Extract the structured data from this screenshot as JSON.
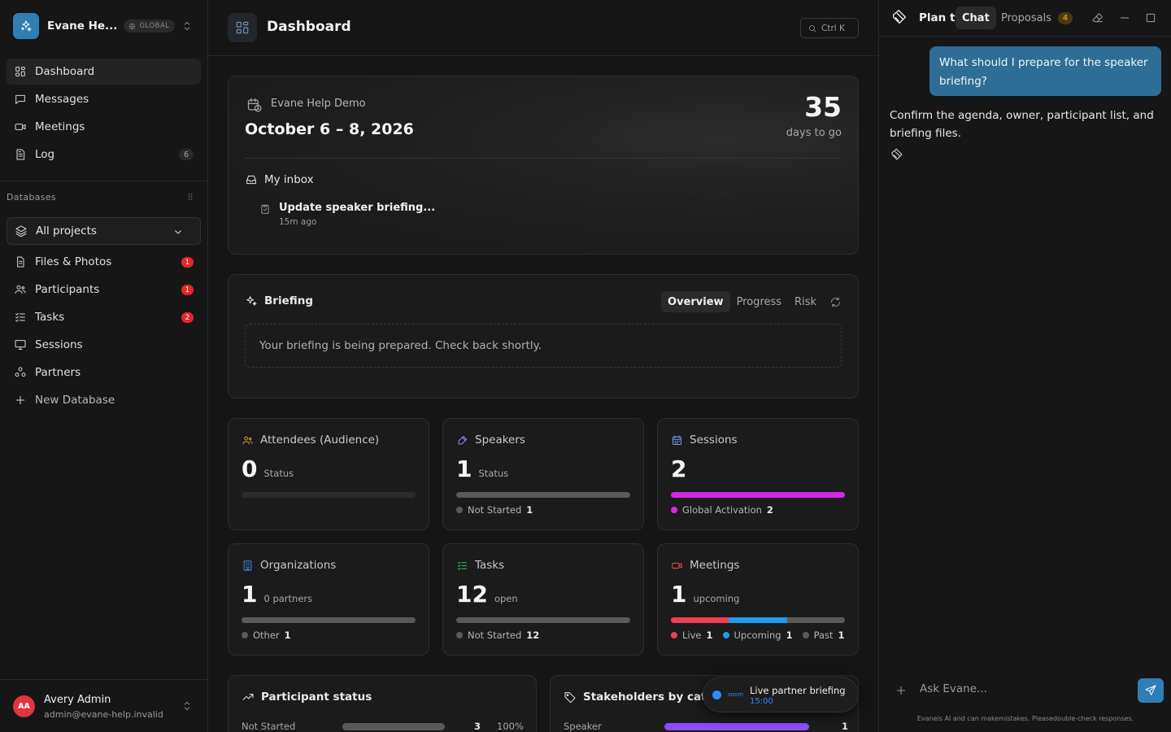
{
  "workspace": {
    "name": "Evane He...",
    "badge": "GLOBAL"
  },
  "nav": [
    {
      "label": "Dashboard",
      "icon": "dashboard-icon",
      "active": true
    },
    {
      "label": "Messages",
      "icon": "message-icon"
    },
    {
      "label": "Meetings",
      "icon": "video-icon"
    },
    {
      "label": "Log",
      "icon": "log-icon",
      "count": "6"
    }
  ],
  "databases": {
    "heading": "Databases",
    "selector": "All projects",
    "items": [
      {
        "label": "Files & Photos",
        "icon": "file-icon",
        "count": "1"
      },
      {
        "label": "Participants",
        "icon": "participants-icon",
        "count": "1"
      },
      {
        "label": "Tasks",
        "icon": "tasks-icon",
        "count": "2"
      },
      {
        "label": "Sessions",
        "icon": "sessions-icon"
      },
      {
        "label": "Partners",
        "icon": "partners-icon"
      }
    ],
    "new_label": "New Database"
  },
  "user": {
    "initials": "AA",
    "name": "Avery Admin",
    "email": "admin@evane-help.invalid"
  },
  "header": {
    "title": "Dashboard",
    "shortcut": "Ctrl K"
  },
  "event": {
    "name": "Evane Help Demo",
    "dates": "October 6 – 8, 2026",
    "days": "35",
    "days_label": "days to go",
    "inbox_title": "My inbox",
    "inbox_item": {
      "title": "Update speaker briefing...",
      "time": "15m ago"
    }
  },
  "briefing": {
    "title": "Briefing",
    "tabs": [
      "Overview",
      "Progress",
      "Risk"
    ],
    "active_tab": "Overview",
    "message": "Your briefing is being prepared. Check back shortly."
  },
  "stats": [
    {
      "title": "Attendees (Audience)",
      "icon": "attendees-icon",
      "icon_color": "#e6a23c",
      "value": "0",
      "sub": "Status",
      "bar": [],
      "legend": []
    },
    {
      "title": "Speakers",
      "icon": "speaker-icon",
      "icon_color": "#a78bfa",
      "value": "1",
      "sub": "Status",
      "bar": [
        {
          "fraction": 1,
          "color": "#5a5a5a"
        }
      ],
      "legend": [
        {
          "label": "Not Started",
          "value": "1",
          "color": "#5a5a5a"
        }
      ]
    },
    {
      "title": "Sessions",
      "icon": "calendar-icon",
      "icon_color": "#7b9ff0",
      "value": "2",
      "sub": "",
      "bar": [
        {
          "fraction": 1,
          "color": "#d627e6"
        }
      ],
      "legend": [
        {
          "label": "Global Activation",
          "value": "2",
          "color": "#d627e6"
        }
      ]
    },
    {
      "title": "Organizations",
      "icon": "building-icon",
      "icon_color": "#4d8ef5",
      "value": "1",
      "sub": "0 partners",
      "bar": [
        {
          "fraction": 1,
          "color": "#5a5a5a"
        }
      ],
      "legend": [
        {
          "label": "Other",
          "value": "1",
          "color": "#5a5a5a"
        }
      ]
    },
    {
      "title": "Tasks",
      "icon": "checklist-icon",
      "icon_color": "#34c759",
      "value": "12",
      "sub": "open",
      "bar": [
        {
          "fraction": 1,
          "color": "#5a5a5a"
        }
      ],
      "legend": [
        {
          "label": "Not Started",
          "value": "12",
          "color": "#5a5a5a"
        }
      ]
    },
    {
      "title": "Meetings",
      "icon": "video-icon",
      "icon_color": "#f0554d",
      "value": "1",
      "sub": "upcoming",
      "bar": [
        {
          "fraction": 0.333,
          "color": "#f03e54"
        },
        {
          "fraction": 0.334,
          "color": "#1e9df0"
        },
        {
          "fraction": 0.333,
          "color": "#5a5a5a"
        }
      ],
      "legend": [
        {
          "label": "Live",
          "value": "1",
          "color": "#f03e54"
        },
        {
          "label": "Upcoming",
          "value": "1",
          "color": "#1e9df0"
        },
        {
          "label": "Past",
          "value": "1",
          "color": "#5a5a5a"
        }
      ]
    }
  ],
  "participant_status": {
    "title": "Participant status",
    "row": {
      "label": "Not Started",
      "value": "3",
      "pct": "100%"
    }
  },
  "stakeholders": {
    "title": "Stakeholders by categ",
    "row": {
      "label": "Speaker",
      "value": "1",
      "color": "#8b4cf6"
    }
  },
  "toast": {
    "brand": "zoom",
    "title": "Live partner briefing",
    "time": "15:00"
  },
  "chat": {
    "title": "Plan th",
    "tab_chat": "Chat",
    "tab_proposals": "Proposals",
    "proposals_count": "4",
    "user_message": "What should I prepare for the speaker briefing?",
    "ai_message": "Confirm the agenda, owner, participant list, and briefing files.",
    "placeholder": "Ask Evane...",
    "disclaimer": "Evaneis AI and can makemistakes. Pleasedouble-check responses."
  },
  "accent_color": "#2f7fb5"
}
